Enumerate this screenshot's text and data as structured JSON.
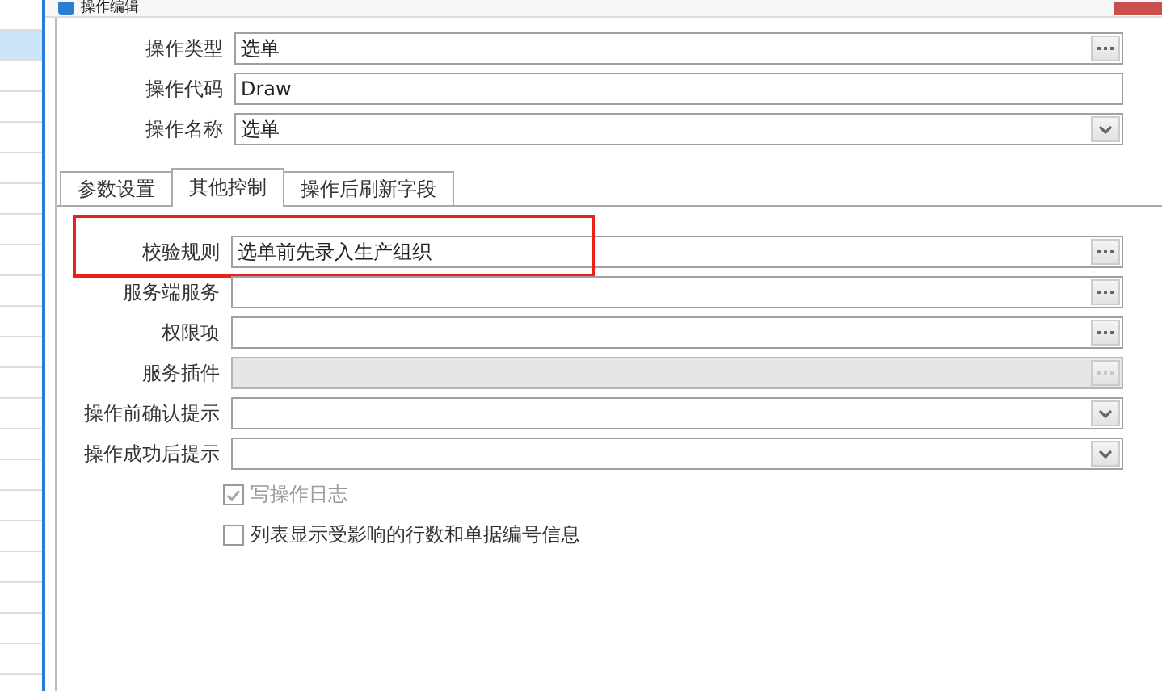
{
  "window": {
    "title": "操作编辑"
  },
  "side_list": {
    "rows": [
      {
        "selected": false
      },
      {
        "selected": true
      },
      {
        "selected": false
      },
      {
        "selected": false
      },
      {
        "selected": false
      },
      {
        "selected": false
      },
      {
        "selected": false
      },
      {
        "selected": false
      },
      {
        "selected": false
      },
      {
        "selected": false
      },
      {
        "selected": false
      },
      {
        "selected": false
      },
      {
        "selected": false
      },
      {
        "selected": false
      },
      {
        "selected": false
      },
      {
        "selected": false
      },
      {
        "selected": false
      },
      {
        "selected": false
      },
      {
        "selected": false
      },
      {
        "selected": false
      },
      {
        "selected": false
      },
      {
        "selected": false
      }
    ]
  },
  "header_fields": [
    {
      "label": "操作类型",
      "value": "选单",
      "kind": "lookup"
    },
    {
      "label": "操作代码",
      "value": "Draw",
      "kind": "text"
    },
    {
      "label": "操作名称",
      "value": "选单",
      "kind": "dropdown"
    }
  ],
  "tabs": [
    {
      "label": "参数设置",
      "selected": false
    },
    {
      "label": "其他控制",
      "selected": true
    },
    {
      "label": "操作后刷新字段",
      "selected": false
    }
  ],
  "fields": [
    {
      "label": "校验规则",
      "value": "选单前先录入生产组织",
      "kind": "lookup",
      "disabled": false,
      "highlighted": true
    },
    {
      "label": "服务端服务",
      "kind": "lookup",
      "disabled": false,
      "highlighted": false
    },
    {
      "label": "权限项",
      "kind": "lookup",
      "disabled": false,
      "highlighted": false
    },
    {
      "label": "服务插件",
      "kind": "lookup",
      "disabled": true,
      "highlighted": false
    },
    {
      "label": "操作前确认提示",
      "kind": "dropdown",
      "disabled": false,
      "highlighted": false
    },
    {
      "label": "操作成功后提示",
      "kind": "dropdown",
      "disabled": false,
      "highlighted": false
    }
  ],
  "checkboxes": [
    {
      "label": "写操作日志",
      "checked": true,
      "disabled": true
    },
    {
      "label": "列表显示受影响的行数和单据编号信息",
      "checked": false,
      "disabled": false
    }
  ]
}
